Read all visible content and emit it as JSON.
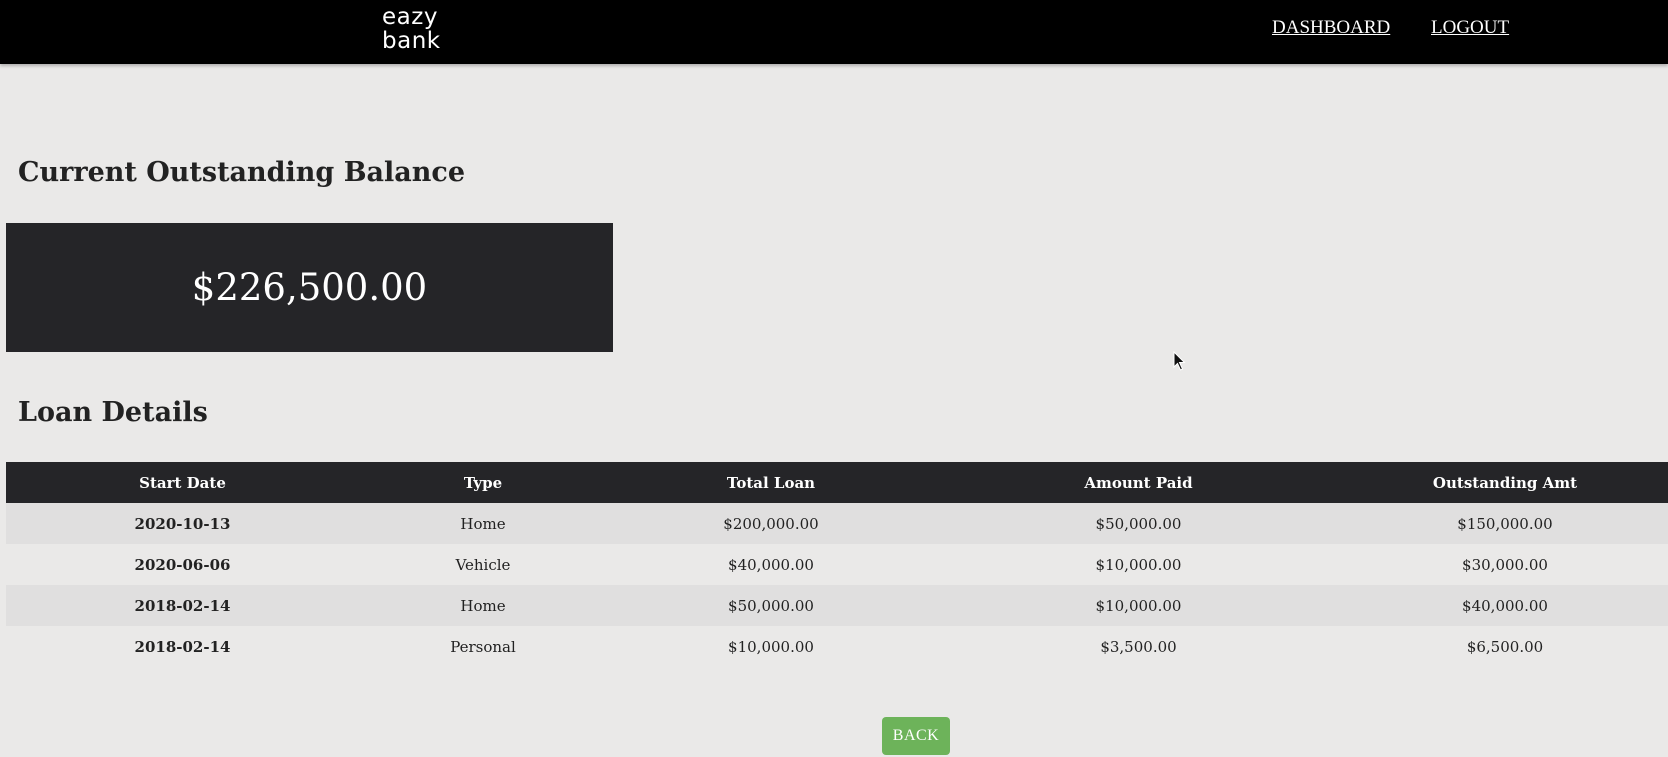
{
  "header": {
    "logo_line1": "eazy",
    "logo_line2": "bank",
    "nav": {
      "dashboard": "DASHBOARD",
      "logout": "LOGOUT"
    }
  },
  "balance": {
    "heading": "Current Outstanding Balance",
    "amount": "$226,500.00"
  },
  "loans": {
    "heading": "Loan Details",
    "columns": [
      "Start Date",
      "Type",
      "Total Loan",
      "Amount Paid",
      "Outstanding Amt"
    ],
    "rows": [
      [
        "2020-10-13",
        "Home",
        "$200,000.00",
        "$50,000.00",
        "$150,000.00"
      ],
      [
        "2020-06-06",
        "Vehicle",
        "$40,000.00",
        "$10,000.00",
        "$30,000.00"
      ],
      [
        "2018-02-14",
        "Home",
        "$50,000.00",
        "$10,000.00",
        "$40,000.00"
      ],
      [
        "2018-02-14",
        "Personal",
        "$10,000.00",
        "$3,500.00",
        "$6,500.00"
      ]
    ]
  },
  "actions": {
    "back_label": "BACK"
  },
  "colors": {
    "navbar": "#000000",
    "page_bg": "#eae9e8",
    "dark_panel": "#252528",
    "back_button": "#6db35a"
  },
  "icons": {
    "cursor": "mouse-pointer-icon"
  }
}
